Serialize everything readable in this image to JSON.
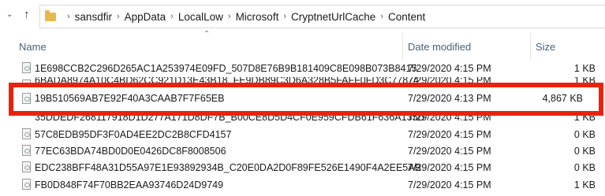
{
  "address_bar": {
    "crumbs": [
      "sansdfir",
      "AppData",
      "LocalLow",
      "Microsoft",
      "CryptnetUrlCache",
      "Content"
    ]
  },
  "columns": {
    "name": "Name",
    "date": "Date modified",
    "size": "Size"
  },
  "rows": [
    {
      "name": "1E698CCB2C296D265AC1A253974E09FD_507D8E76B9B181409C8E098B073B8415",
      "date": "7/29/2020 4:15 PM",
      "size": "1 KB"
    },
    {
      "name": "6BADA8974A10C4BD62CC921D13E43B18_FE9DB89C3D6A328B5FAFF0FD3C77874",
      "date": "7/29/2020 4:15 PM",
      "size": "1 KB"
    },
    {
      "name": "19B510569AB7E92F40A3CAAB7F7F65EB",
      "date": "7/29/2020 4:13 PM",
      "size": "4,867 KB"
    },
    {
      "name": "35DDEDF268117918D1D277A171D8DF7B_B00CE8D5D4CF0E959CFDB61F636A135D",
      "date": "7/29/2020 4:15 PM",
      "size": "1 KB"
    },
    {
      "name": "57C8EDB95DF3F0AD4EE2DC2B8CFD4157",
      "date": "7/29/2020 4:15 PM",
      "size": "0 KB"
    },
    {
      "name": "77EC63BDA74BD0D0E0426DC8F8008506",
      "date": "7/29/2020 4:15 PM",
      "size": "0 KB"
    },
    {
      "name": "EDC238BFF48A31D55A97E1E93892934B_C20E0DA2D0F89FE526E1490F4A2EE5AB",
      "date": "7/29/2020 4:15 PM",
      "size": "0 KB"
    },
    {
      "name": "FB0D848F74F70BB2EAA93746D24D9749",
      "date": "7/29/2020 4:15 PM",
      "size": "1 KB"
    }
  ],
  "highlight_color": "#e8230c"
}
